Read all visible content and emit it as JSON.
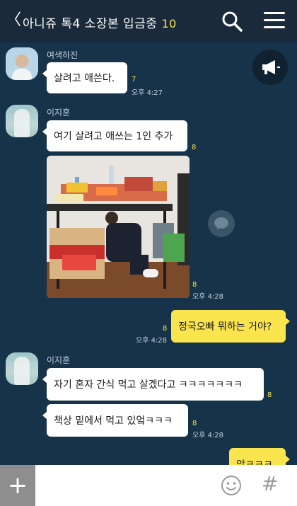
{
  "header": {
    "back_glyph": "〈",
    "title": "아니쥬 톡4 소장본 입금중",
    "member_count": "10",
    "accent": "#f6e24a"
  },
  "icons": {
    "back": "back-icon",
    "search": "search-icon",
    "menu": "menu-icon",
    "megaphone": "megaphone-icon",
    "share": "share-icon",
    "plus": "plus-icon",
    "emoji": "emoji-icon",
    "hash": "hash-icon"
  },
  "messages": [
    {
      "sender": "여색하진",
      "text": "살려고 애쓴다.",
      "unread": "7",
      "time": "오후 4:27"
    },
    {
      "sender": "이지훈",
      "text": "여기 살려고 애쓰는 1인 추가",
      "unread": "8"
    },
    {
      "type": "photo",
      "unread": "8",
      "time": "오후 4:28"
    },
    {
      "mine": true,
      "text": "정국오빠 뭐하는 거야?",
      "unread": "8",
      "time": "오후 4:28"
    },
    {
      "sender": "이지훈",
      "text": "자기 혼자 간식 먹고 살겠다고 ㅋㅋㅋㅋㅋㅋㅋ",
      "unread": "8"
    },
    {
      "text": "책상 밑에서 먹고 있엌ㅋㅋㅋ",
      "unread": "8",
      "time": "오후 4:28"
    },
    {
      "mine": true,
      "text": "앜ㅋㅋㅋ"
    }
  ],
  "input": {
    "placeholder": "",
    "plus_label": "+",
    "hash_label": "#"
  },
  "colors": {
    "background": "#17334a",
    "header": "#1a2a3a",
    "my_bubble": "#fbe54f",
    "their_bubble": "#ffffff",
    "unread_count": "#f6e24a"
  }
}
